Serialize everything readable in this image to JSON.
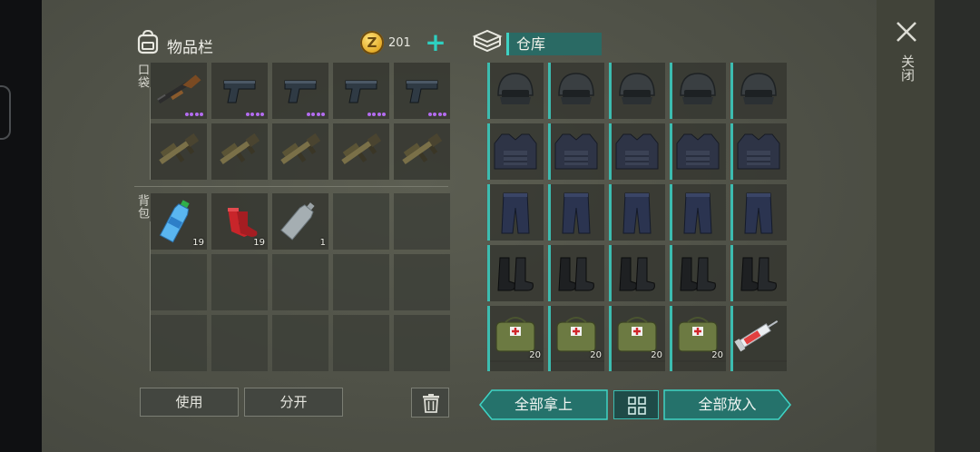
{
  "close": {
    "label": "关闭",
    "icon": "close-icon"
  },
  "inventory": {
    "title": "物品栏",
    "icon": "backpack-icon",
    "coins": {
      "count": "201",
      "icon": "coin-icon"
    },
    "pocket_label": "口袋",
    "backpack_label": "背包",
    "pocket": [
      {
        "item": "shotgun",
        "rarity_dots": 4
      },
      {
        "item": "pistol",
        "rarity_dots": 4
      },
      {
        "item": "pistol",
        "rarity_dots": 4
      },
      {
        "item": "pistol",
        "rarity_dots": 4
      },
      {
        "item": "pistol",
        "rarity_dots": 4
      },
      {
        "item": "grenade-launcher"
      },
      {
        "item": "grenade-launcher"
      },
      {
        "item": "grenade-launcher"
      },
      {
        "item": "grenade-launcher"
      },
      {
        "item": "grenade-launcher"
      }
    ],
    "backpack": [
      {
        "item": "water-bottle",
        "qty": "19"
      },
      {
        "item": "red-socks",
        "qty": "19"
      },
      {
        "item": "empty-bottle",
        "qty": "1"
      },
      {
        "item": ""
      },
      {
        "item": ""
      },
      {
        "item": ""
      },
      {
        "item": ""
      },
      {
        "item": ""
      },
      {
        "item": ""
      },
      {
        "item": ""
      },
      {
        "item": ""
      },
      {
        "item": ""
      },
      {
        "item": ""
      },
      {
        "item": ""
      },
      {
        "item": ""
      }
    ]
  },
  "warehouse": {
    "title": "仓库",
    "icon": "stack-icon",
    "items": [
      {
        "item": "helmet"
      },
      {
        "item": "helmet"
      },
      {
        "item": "helmet"
      },
      {
        "item": "helmet"
      },
      {
        "item": "helmet"
      },
      {
        "item": "vest"
      },
      {
        "item": "vest"
      },
      {
        "item": "vest"
      },
      {
        "item": "vest"
      },
      {
        "item": "vest"
      },
      {
        "item": "pants"
      },
      {
        "item": "pants"
      },
      {
        "item": "pants"
      },
      {
        "item": "pants"
      },
      {
        "item": "pants"
      },
      {
        "item": "boots"
      },
      {
        "item": "boots"
      },
      {
        "item": "boots"
      },
      {
        "item": "boots"
      },
      {
        "item": "boots"
      },
      {
        "item": "medkit-bag",
        "qty": "20"
      },
      {
        "item": "medkit-bag",
        "qty": "20"
      },
      {
        "item": "medkit-bag",
        "qty": "20"
      },
      {
        "item": "medkit-bag",
        "qty": "20"
      },
      {
        "item": "syringe"
      }
    ]
  },
  "buttons": {
    "use": "使用",
    "split": "分开",
    "take_all": "全部拿上",
    "put_all": "全部放入",
    "trash_icon": "trash-icon",
    "sort_icon": "grid-icon"
  },
  "colors": {
    "accent": "#3cbcb0",
    "rarity": "#b46cf0",
    "coin": "#e0a520"
  }
}
